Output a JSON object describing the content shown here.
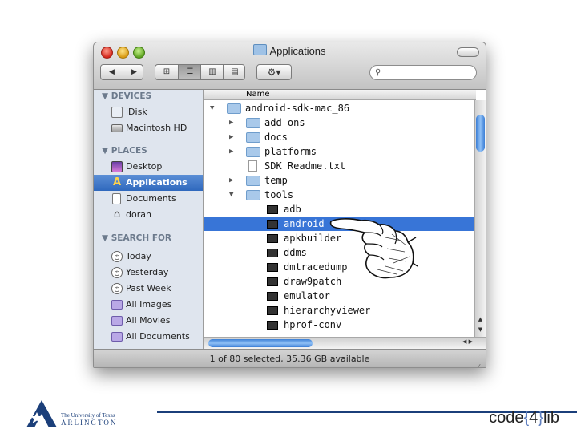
{
  "window": {
    "title": "Applications",
    "status": "1 of 80 selected, 35.36 GB available"
  },
  "toolbar": {
    "back_label": "◀",
    "forward_label": "▶",
    "view_icon_label": "⊞",
    "view_list_label": "☰",
    "view_column_label": "▥",
    "view_coverflow_label": "▤",
    "action_label": "⚙▾",
    "search_placeholder": ""
  },
  "sidebar": {
    "devices_header": "▼ DEVICES",
    "places_header": "▼ PLACES",
    "search_header": "▼ SEARCH FOR",
    "devices": [
      {
        "label": "iDisk",
        "icon": "idisk-icon"
      },
      {
        "label": "Macintosh HD",
        "icon": "hard-drive-icon"
      }
    ],
    "places": [
      {
        "label": "Desktop",
        "icon": "desktop-icon"
      },
      {
        "label": "Applications",
        "icon": "applications-icon",
        "selected": true
      },
      {
        "label": "Documents",
        "icon": "documents-icon"
      },
      {
        "label": "doran",
        "icon": "home-icon"
      }
    ],
    "search_for": [
      {
        "label": "Today",
        "icon": "clock-icon"
      },
      {
        "label": "Yesterday",
        "icon": "clock-icon"
      },
      {
        "label": "Past Week",
        "icon": "clock-icon"
      },
      {
        "label": "All Images",
        "icon": "smart-folder-icon"
      },
      {
        "label": "All Movies",
        "icon": "smart-folder-icon"
      },
      {
        "label": "All Documents",
        "icon": "smart-folder-icon"
      }
    ]
  },
  "list": {
    "column_name": "Name",
    "rows": [
      {
        "label": "android-sdk-mac_86",
        "level": 0,
        "type": "folder",
        "expanded": true
      },
      {
        "label": "add-ons",
        "level": 1,
        "type": "folder",
        "expanded": false
      },
      {
        "label": "docs",
        "level": 1,
        "type": "folder",
        "expanded": false
      },
      {
        "label": "platforms",
        "level": 1,
        "type": "folder",
        "expanded": false
      },
      {
        "label": "SDK Readme.txt",
        "level": 1,
        "type": "document"
      },
      {
        "label": "temp",
        "level": 1,
        "type": "folder",
        "expanded": false
      },
      {
        "label": "tools",
        "level": 1,
        "type": "folder",
        "expanded": true
      },
      {
        "label": "adb",
        "level": 2,
        "type": "executable"
      },
      {
        "label": "android",
        "level": 2,
        "type": "executable",
        "selected": true
      },
      {
        "label": "apkbuilder",
        "level": 2,
        "type": "executable"
      },
      {
        "label": "ddms",
        "level": 2,
        "type": "executable"
      },
      {
        "label": "dmtracedump",
        "level": 2,
        "type": "executable"
      },
      {
        "label": "draw9patch",
        "level": 2,
        "type": "executable"
      },
      {
        "label": "emulator",
        "level": 2,
        "type": "executable"
      },
      {
        "label": "hierarchyviewer",
        "level": 2,
        "type": "executable"
      },
      {
        "label": "hprof-conv",
        "level": 2,
        "type": "executable"
      }
    ]
  },
  "footer": {
    "uta_line1": "The University of Texas",
    "uta_line2": "ARLINGTON",
    "code4lib_pre": "code",
    "code4lib_brace_open": "{",
    "code4lib_num": "4",
    "code4lib_brace_close": "}",
    "code4lib_post": "lib"
  },
  "colors": {
    "selection": "#3875d7",
    "sidebar_bg": "#dfe5ee",
    "footer_blue": "#1b3f7a"
  }
}
